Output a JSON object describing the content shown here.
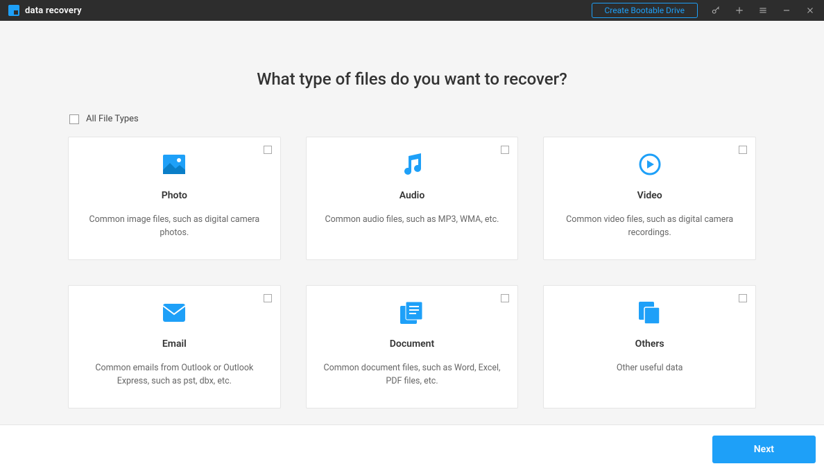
{
  "titlebar": {
    "app_name": "data recovery",
    "bootable_button": "Create Bootable Drive"
  },
  "main": {
    "heading": "What type of files do you want to recover?",
    "all_types_label": "All File Types"
  },
  "cards": [
    {
      "id": "photo",
      "title": "Photo",
      "desc": "Common image files, such as digital camera photos.",
      "icon": "image-icon"
    },
    {
      "id": "audio",
      "title": "Audio",
      "desc": "Common audio files, such as MP3, WMA, etc.",
      "icon": "music-icon"
    },
    {
      "id": "video",
      "title": "Video",
      "desc": "Common video files, such as digital camera recordings.",
      "icon": "play-icon"
    },
    {
      "id": "email",
      "title": "Email",
      "desc": "Common emails from Outlook or Outlook Express, such as pst, dbx, etc.",
      "icon": "mail-icon"
    },
    {
      "id": "document",
      "title": "Document",
      "desc": "Common document files, such as Word, Excel, PDF files, etc.",
      "icon": "document-icon"
    },
    {
      "id": "others",
      "title": "Others",
      "desc": "Other useful data",
      "icon": "copy-icon"
    }
  ],
  "footer": {
    "next_button": "Next"
  }
}
